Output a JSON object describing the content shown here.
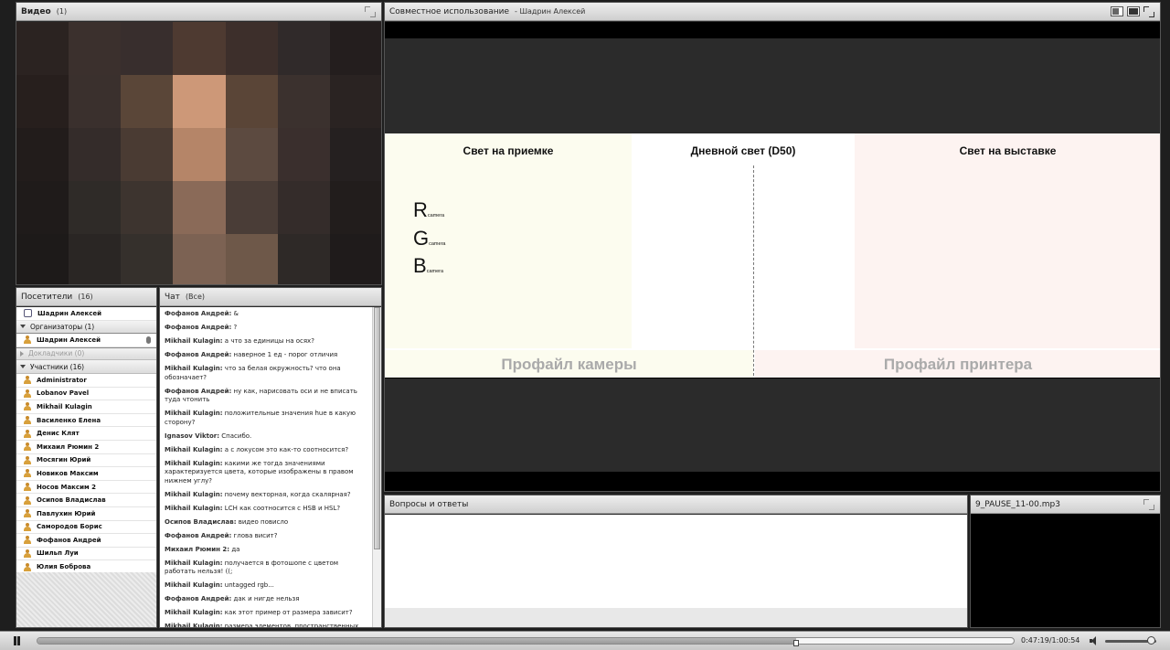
{
  "video_pod": {
    "title": "Видео",
    "count": "(1)"
  },
  "video_pixels": [
    [
      "#2b2321",
      "#3b302d",
      "#382e2d",
      "#4e3a31",
      "#3d2f2b",
      "#302a2a",
      "#241e1e"
    ],
    [
      "#271f1d",
      "#3a302d",
      "#5a4638",
      "#cd9878",
      "#5a4537",
      "#3b312e",
      "#2a2322"
    ],
    [
      "#221c1b",
      "#342c2a",
      "#4a3b33",
      "#b58568",
      "#5c4a40",
      "#3a2f2d",
      "#252020"
    ],
    [
      "#1f1b1a",
      "#2f2b28",
      "#3d342f",
      "#8a6a58",
      "#4a3d37",
      "#342c2a",
      "#221d1c"
    ],
    [
      "#1d1a19",
      "#2a2624",
      "#35302c",
      "#7c6253",
      "#6e5849",
      "#2e2927",
      "#1f1b1b"
    ]
  ],
  "attendees_pod": {
    "title": "Посетители",
    "count": "(16)",
    "host_entry": "Шадрин Алексей",
    "organizers_label": "Организаторы (1)",
    "organizer": "Шадрин Алексей",
    "presenters_label": "Докладчики (0)",
    "participants_label": "Участники (16)",
    "participants": [
      "Administrator",
      "Lobanov Pavel",
      "Mikhail Kulagin",
      "Василенко Елена",
      "Денис Клят",
      "Михаил Рюмин 2",
      "Мосягин Юрий",
      "Новиков Максим",
      "Носов Максим 2",
      "Осипов Владислав",
      "Павлухин Юрий",
      "Самородов Борис",
      "Фофанов Андрей",
      "Шильп Луи",
      "Юлия Боброва"
    ]
  },
  "chat_pod": {
    "title": "Чат",
    "filter": "(Все)",
    "messages": [
      {
        "author": "Фофанов Андрей:",
        "text": " &"
      },
      {
        "author": "Фофанов Андрей:",
        "text": " ?"
      },
      {
        "author": "Mikhail Kulagin:",
        "text": " а что за единицы на осях?"
      },
      {
        "author": "Фофанов Андрей:",
        "text": " наверное 1 ед - порог отличия"
      },
      {
        "author": "Mikhail Kulagin:",
        "text": " что за белая окружность? что она обозначает?"
      },
      {
        "author": "Фофанов Андрей:",
        "text": " ну как, нарисовать оси и не вписать туда чтонить"
      },
      {
        "author": "Mikhail Kulagin:",
        "text": " положительные значения hue в какую сторону?"
      },
      {
        "author": "Ignasov Viktor:",
        "text": " Спасибо."
      },
      {
        "author": "Mikhail Kulagin:",
        "text": " а с локусом это как-то соотносится?"
      },
      {
        "author": "Mikhail Kulagin:",
        "text": " какими же тогда значениями характеризуется цвета, которые изображены в правом нижнем углу?"
      },
      {
        "author": "Mikhail Kulagin:",
        "text": " почему векторная, когда скалярная?"
      },
      {
        "author": "Mikhail Kulagin:",
        "text": " LCH как соотносится с HSB и HSL?"
      },
      {
        "author": "Осипов Владислав:",
        "text": " видео повисло"
      },
      {
        "author": "Фофанов Андрей:",
        "text": " глова висит?"
      },
      {
        "author": "Михаил Рюмин 2:",
        "text": " да"
      },
      {
        "author": "Mikhail Kulagin:",
        "text": " получается в фотошопе с цветом работать нельзя! ((;"
      },
      {
        "author": "Mikhail Kulagin:",
        "text": " untagged rgb..."
      },
      {
        "author": "Фофанов Андрей:",
        "text": " дак и нигде нельзя"
      },
      {
        "author": "Mikhail Kulagin:",
        "text": " как этот пример от размера зависит?"
      },
      {
        "author": "Mikhail Kulagin:",
        "text": " размера элементов, пространственных частот"
      }
    ]
  },
  "share_pod": {
    "title": "Совместное использование",
    "presenter": "- Шадрин Алексей",
    "slide": {
      "zone1_title": "Свет на приемке",
      "zone2_title": "Дневной свет (D50)",
      "zone3_title": "Свет на выставке",
      "rgb": [
        {
          "letter": "R",
          "sub": "camera"
        },
        {
          "letter": "G",
          "sub": "camera"
        },
        {
          "letter": "B",
          "sub": "camera"
        }
      ],
      "camera_profile": "Профайл камеры",
      "printer_profile": "Профайл принтера"
    }
  },
  "qa_pod": {
    "title": "Вопросы и ответы"
  },
  "media_pod": {
    "title": "9_PAUSE_11-00.mp3"
  },
  "playback": {
    "time": "0:47:19/1:00:54",
    "progress": 0.777,
    "volume": 0.9
  }
}
